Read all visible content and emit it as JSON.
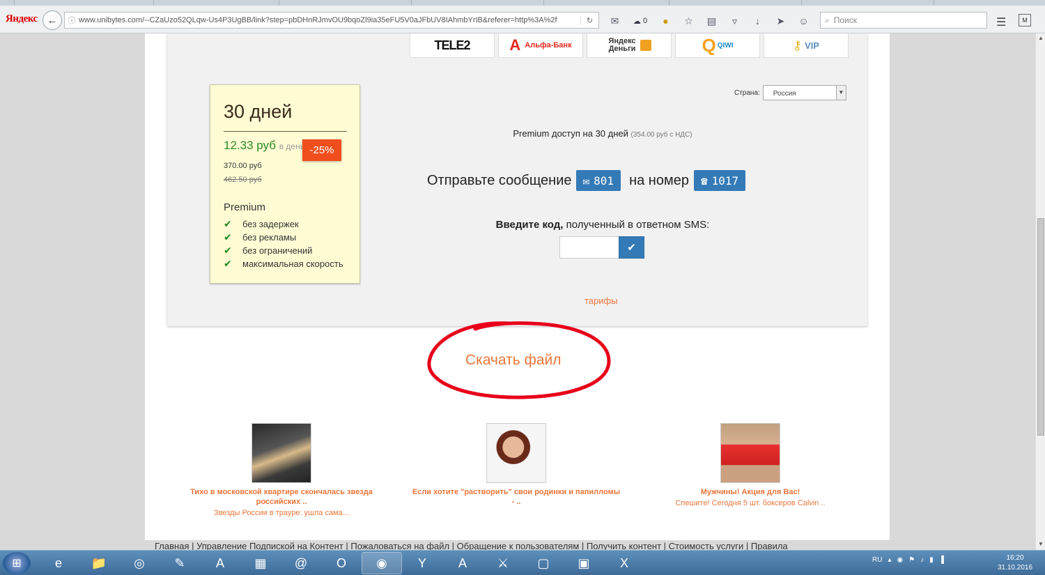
{
  "browser": {
    "brand": "Яндекс",
    "url": "www.unibytes.com/--CZaUzo52QLqw-Us4P3UgBB/link?step=pbDHnRJmvOU9bqoZl9ia35eFU5V0aJFbUV8IAhmbYrIB&referer=http%3A%2f",
    "notif_count": "0",
    "search_placeholder": "Поиск"
  },
  "payments": [
    "TELE2",
    "Альфа-Банк",
    "Яндекс Деньги",
    "QIWI",
    "VIP"
  ],
  "plan": {
    "days": "30 дней",
    "price_per_day": "12.33 руб",
    "per_day_suffix": "в день",
    "price": "370.00 руб",
    "old_price": "462.50 руб",
    "discount": "-25%",
    "title": "Premium",
    "features": [
      "без задержек",
      "без рекламы",
      "без ограничений",
      "максимальная скорость"
    ]
  },
  "country": {
    "label": "Страна:",
    "value": "Россия"
  },
  "offer": {
    "premium_text": "Premium доступ на 30 дней",
    "premium_note": "(354.00 руб с НДС)",
    "send_text": "Отправьте сообщение",
    "sms_code": "801",
    "to_number_text": "на номер",
    "number": "1017",
    "code_label_bold": "Введите код,",
    "code_label_rest": " полученный в ответном SMS:",
    "tariffs": "тарифы"
  },
  "download_label": "Скачать файл",
  "news": [
    {
      "title": "Тихо в московской квартире скончалась звезда российских ..",
      "desc": "Звезды России в трауре: ушла сама..."
    },
    {
      "title": "Если хотите \"растворить\" свои родинки и папилломы - ..",
      "desc": ""
    },
    {
      "title": "Мужчины! Акция для Вас!",
      "desc": "Спешите! Сегодня 5 шт. боксеров Calvin .."
    }
  ],
  "footer": "Главная | Управление Подпиской на Контент | Пожаловаться на файл | Обращение к пользователям | Получить контент | Стоимость услуги | Правила",
  "taskbar": {
    "lang": "RU",
    "time": "16:20",
    "date": "31.10.2016"
  },
  "colors": {
    "accent": "#337ab7",
    "link": "#e8763a",
    "discount": "#f04e1d",
    "price": "#2a8a24",
    "card_bg": "#fffcd4"
  }
}
